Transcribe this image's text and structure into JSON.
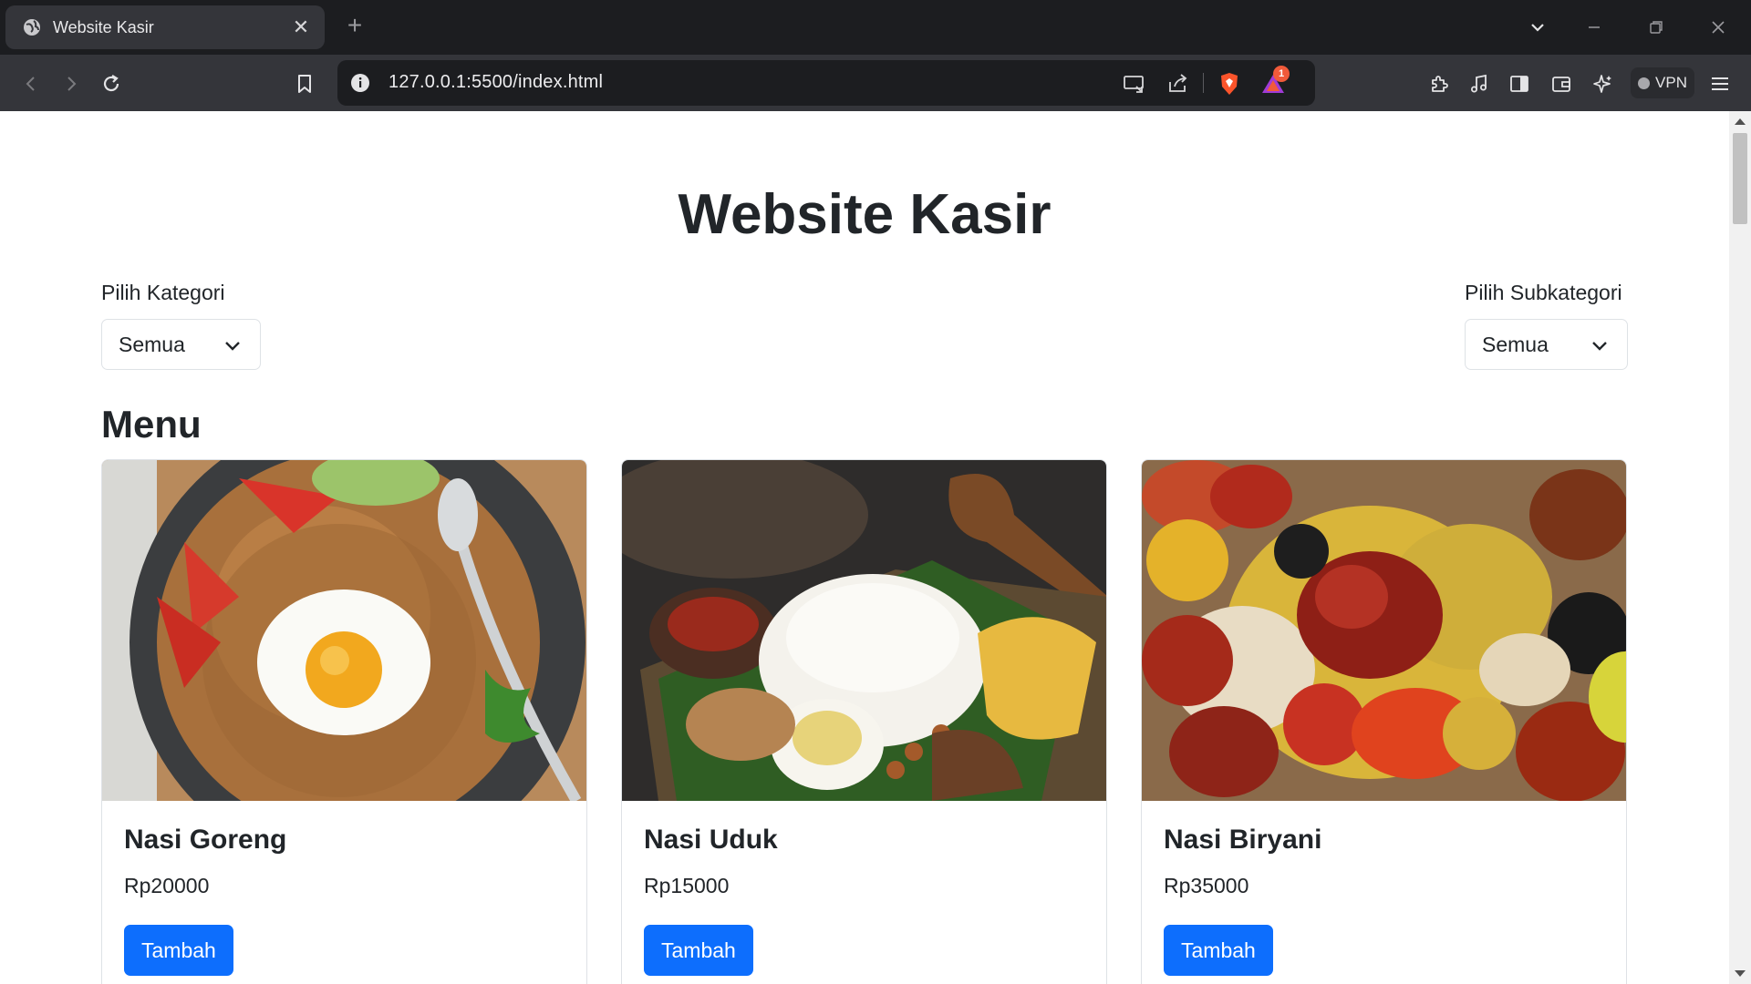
{
  "browser": {
    "tab_title": "Website Kasir",
    "url": "127.0.0.1:5500/index.html",
    "vpn_label": "VPN",
    "notification_count": "1"
  },
  "page": {
    "title": "Website Kasir",
    "category_filter": {
      "label": "Pilih Kategori",
      "selected": "Semua"
    },
    "subcategory_filter": {
      "label": "Pilih Subkategori",
      "selected": "Semua"
    },
    "menu_heading": "Menu",
    "items": [
      {
        "name": "Nasi Goreng",
        "price": "Rp20000",
        "button": "Tambah"
      },
      {
        "name": "Nasi Uduk",
        "price": "Rp15000",
        "button": "Tambah"
      },
      {
        "name": "Nasi Biryani",
        "price": "Rp35000",
        "button": "Tambah"
      }
    ]
  },
  "colors": {
    "primary_button": "#0d6efd",
    "text": "#212529",
    "chrome_dark": "#1c1d20",
    "chrome_toolbar": "#34353a"
  },
  "icons": [
    "globe-icon",
    "close-icon",
    "plus-icon",
    "chevron-down-icon",
    "minimize-icon",
    "restore-icon",
    "back-icon",
    "forward-icon",
    "reload-icon",
    "bookmark-icon",
    "info-icon",
    "cast-icon",
    "share-icon",
    "brave-shield-icon",
    "brave-rewards-icon",
    "extensions-icon",
    "music-icon",
    "sidebar-icon",
    "wallet-icon",
    "leo-ai-icon",
    "hamburger-menu-icon"
  ]
}
